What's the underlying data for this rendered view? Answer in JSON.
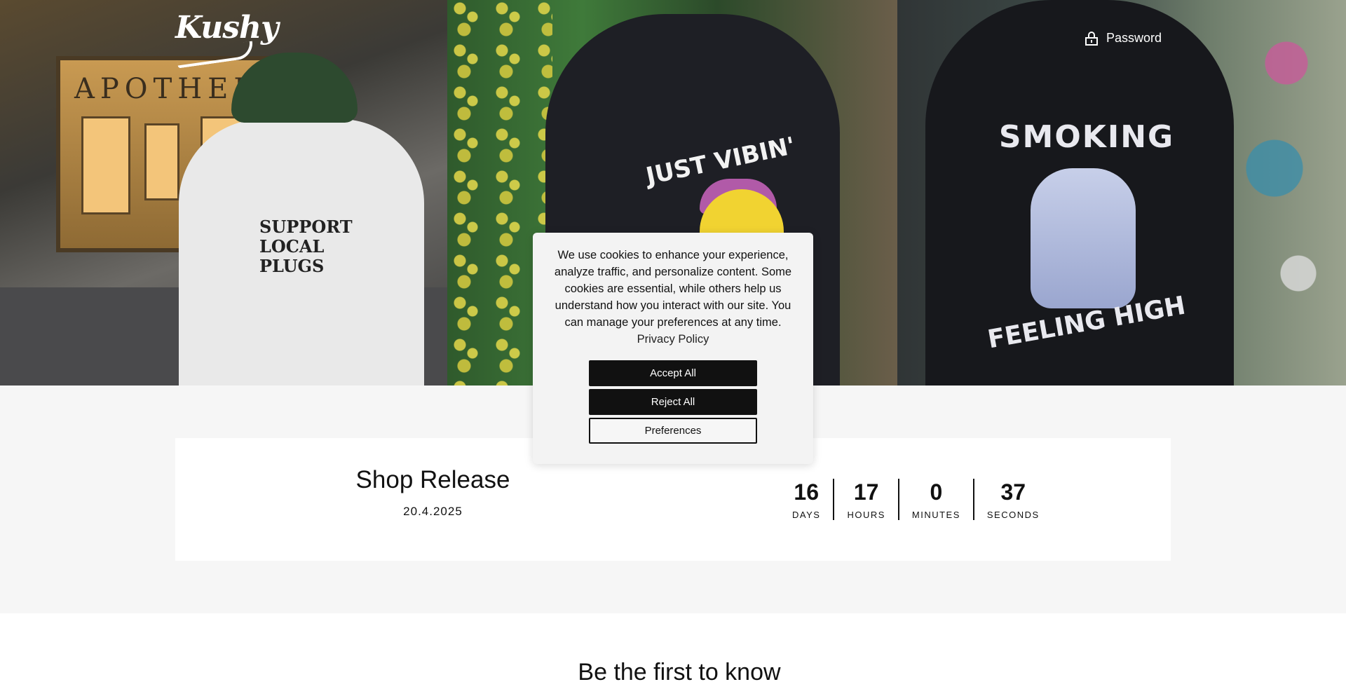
{
  "header": {
    "logo_text": "Kushy",
    "password_label": "Password"
  },
  "hero": {
    "store_sign": "APOTHEKE",
    "shirt_print": "SUPPORT LOCAL PLUGS",
    "hoodie_2_print": "JUST VIBIN'",
    "hoodie_3_print_top": "SMOKING",
    "hoodie_3_print_bottom": "FEELING HIGH"
  },
  "countdown": {
    "title": "Shop Release",
    "date": "20.4.2025",
    "units": [
      {
        "value": "16",
        "label": "DAYS"
      },
      {
        "value": "17",
        "label": "HOURS"
      },
      {
        "value": "0",
        "label": "MINUTES"
      },
      {
        "value": "37",
        "label": "SECONDS"
      }
    ]
  },
  "newsletter": {
    "heading": "Be the first to know"
  },
  "cookie_banner": {
    "text": "We use cookies to enhance your experience, analyze traffic, and personalize content. Some cookies are essential, while others help us understand how you interact with our site. You can manage your preferences at any time.",
    "privacy_link": "Privacy Policy",
    "accept_label": "Accept All",
    "reject_label": "Reject All",
    "preferences_label": "Preferences"
  },
  "colors": {
    "primary_button": "#111111",
    "section_bg": "#f6f6f6",
    "banner_bg": "#f3f3f3"
  }
}
